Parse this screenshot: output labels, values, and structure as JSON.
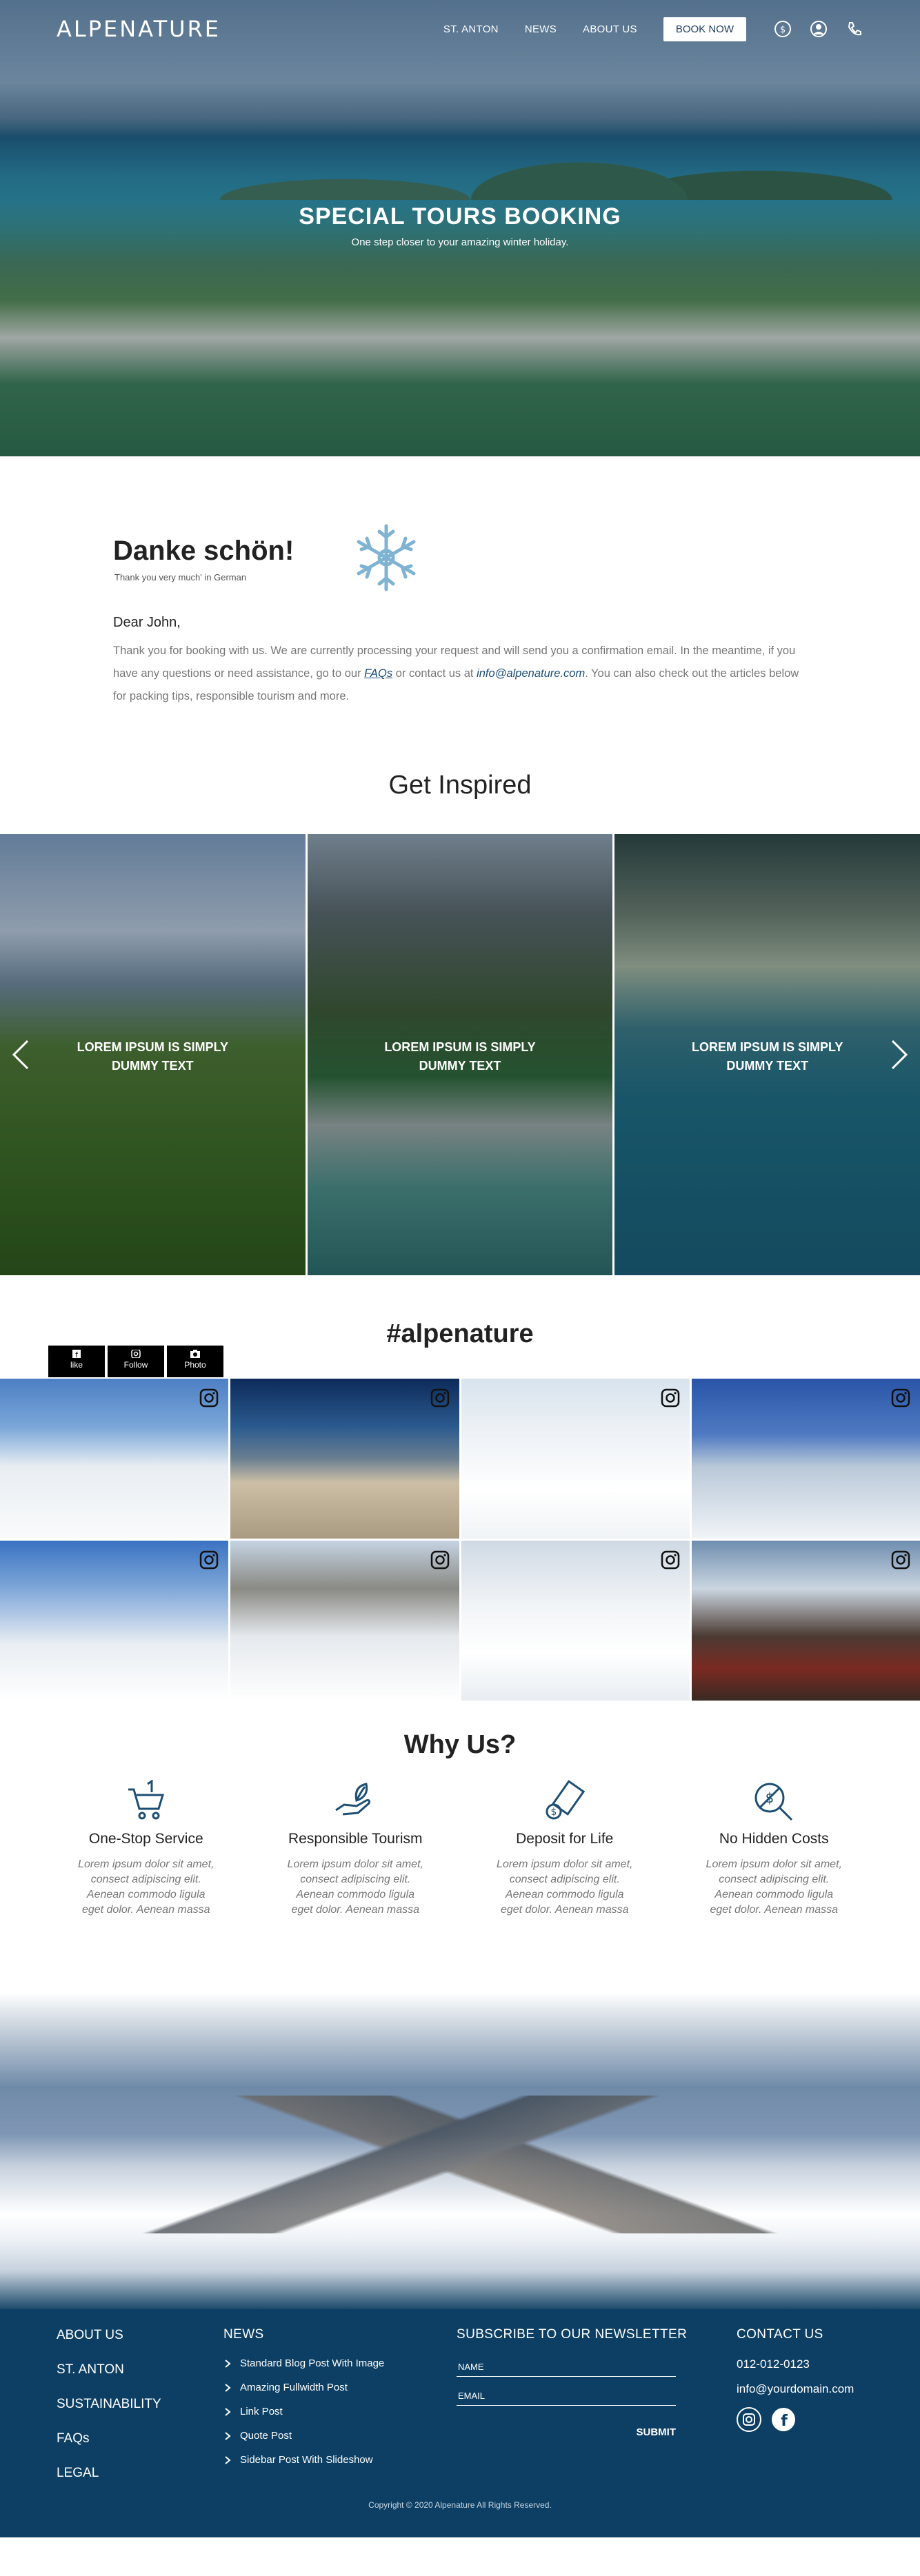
{
  "header": {
    "logo": "ALPENATURE",
    "nav": [
      "ST. ANTON",
      "NEWS",
      "ABOUT US"
    ],
    "book_now": "BOOK NOW",
    "icons": [
      "currency-icon",
      "user-icon",
      "phone-icon"
    ]
  },
  "hero": {
    "title": "SPECIAL TOURS BOOKING",
    "subtitle": "One step closer to your amazing winter holiday."
  },
  "thanks": {
    "heading": "Danke schön!",
    "subheading": "Thank you very much' in German",
    "salutation": "Dear John,",
    "message_part1": "Thank you for booking with us. We are currently processing your request and will send you a confirmation email. In the meantime, if you have any questions or need assistance, go to our ",
    "faq_link": "FAQs",
    "message_part2": " or contact us at ",
    "email_link": "info@alpenature.com",
    "message_part3": ". You can also check out the articles below for packing tips, responsible tourism and more."
  },
  "inspired": {
    "title": "Get Inspired",
    "slides": [
      "LOREM IPSUM IS SIMPLY DUMMY TEXT",
      "LOREM IPSUM IS SIMPLY DUMMY TEXT",
      "LOREM IPSUM IS SIMPLY DUMMY TEXT"
    ]
  },
  "instagram": {
    "title": "#alpenature",
    "buttons": [
      "like",
      "Follow",
      "Photo"
    ]
  },
  "why": {
    "title": "Why Us?",
    "features": [
      {
        "title": "One-Stop Service",
        "text": "Lorem ipsum dolor sit amet, consect adipiscing elit. Aenean commodo ligula eget dolor. Aenean massa",
        "icon": "cart-icon"
      },
      {
        "title": "Responsible Tourism",
        "text": "Lorem ipsum dolor sit amet, consect adipiscing elit. Aenean commodo ligula eget dolor. Aenean massa",
        "icon": "hand-leaf-icon"
      },
      {
        "title": "Deposit for Life",
        "text": "Lorem ipsum dolor sit amet, consect adipiscing elit. Aenean commodo ligula eget dolor. Aenean massa",
        "icon": "cash-icon"
      },
      {
        "title": "No Hidden Costs",
        "text": "Lorem ipsum dolor sit amet, consect adipiscing elit. Aenean commodo ligula eget dolor. Aenean massa",
        "icon": "no-cost-icon"
      }
    ]
  },
  "footer": {
    "links": [
      "ABOUT US",
      "ST. ANTON",
      "SUSTAINABILITY",
      "FAQs",
      "LEGAL"
    ],
    "news_title": "NEWS",
    "news": [
      "Standard Blog Post With Image",
      "Amazing Fullwidth Post",
      "Link Post",
      "Quote Post",
      "Sidebar Post With Slideshow"
    ],
    "newsletter_title": "SUBSCRIBE TO OUR NEWSLETTER",
    "name_placeholder": "NAME",
    "email_placeholder": "EMAIL",
    "submit": "SUBMIT",
    "contact_title": "CONTACT US",
    "phone": "012-012-0123",
    "email": "info@yourdomain.com",
    "copyright": "Copyright © 2020  Alpenature  All Rights Reserved."
  }
}
